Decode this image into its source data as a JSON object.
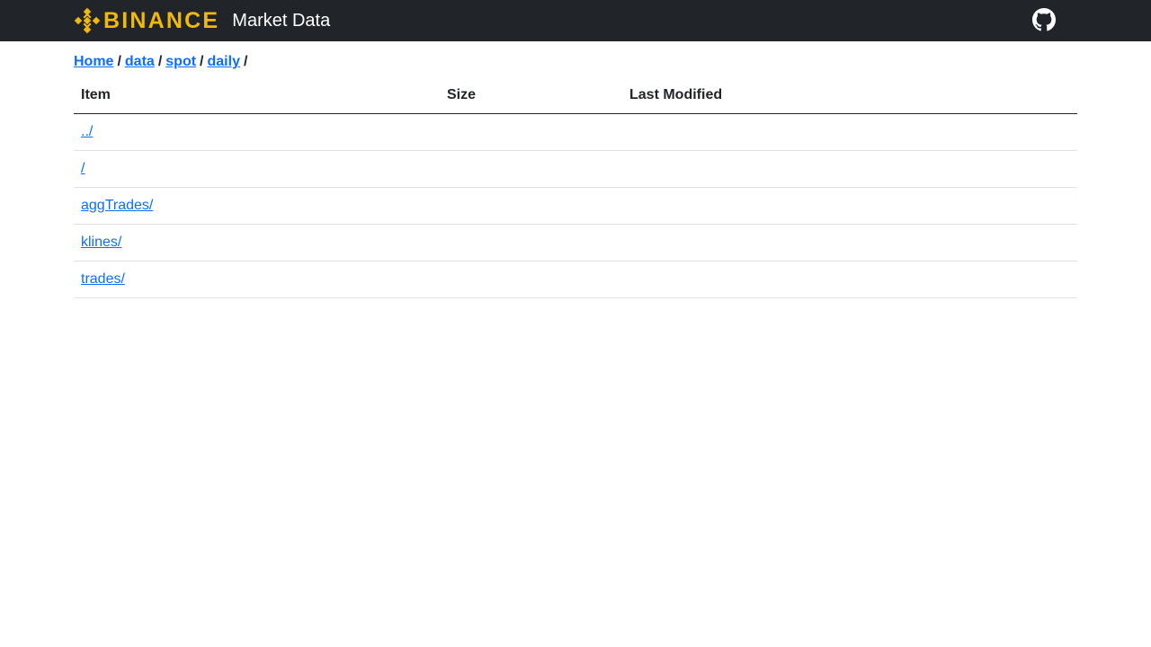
{
  "header": {
    "brand_name": "BINANCE",
    "title": "Market Data",
    "brand_color": "#F0B90B",
    "background_color": "#212529",
    "github_icon": "github-icon"
  },
  "breadcrumb": {
    "items": [
      "Home",
      "data",
      "spot",
      "daily"
    ],
    "separator": "/"
  },
  "table": {
    "headers": {
      "item": "Item",
      "size": "Size",
      "last_modified": "Last Modified"
    },
    "rows": [
      {
        "item": "../",
        "size": "",
        "last_modified": ""
      },
      {
        "item": "/",
        "size": "",
        "last_modified": ""
      },
      {
        "item": "aggTrades/",
        "size": "",
        "last_modified": ""
      },
      {
        "item": "klines/",
        "size": "",
        "last_modified": ""
      },
      {
        "item": "trades/",
        "size": "",
        "last_modified": ""
      }
    ]
  },
  "colors": {
    "link": "#0d6efd",
    "text": "#212529",
    "row_border": "#dee2e6"
  }
}
